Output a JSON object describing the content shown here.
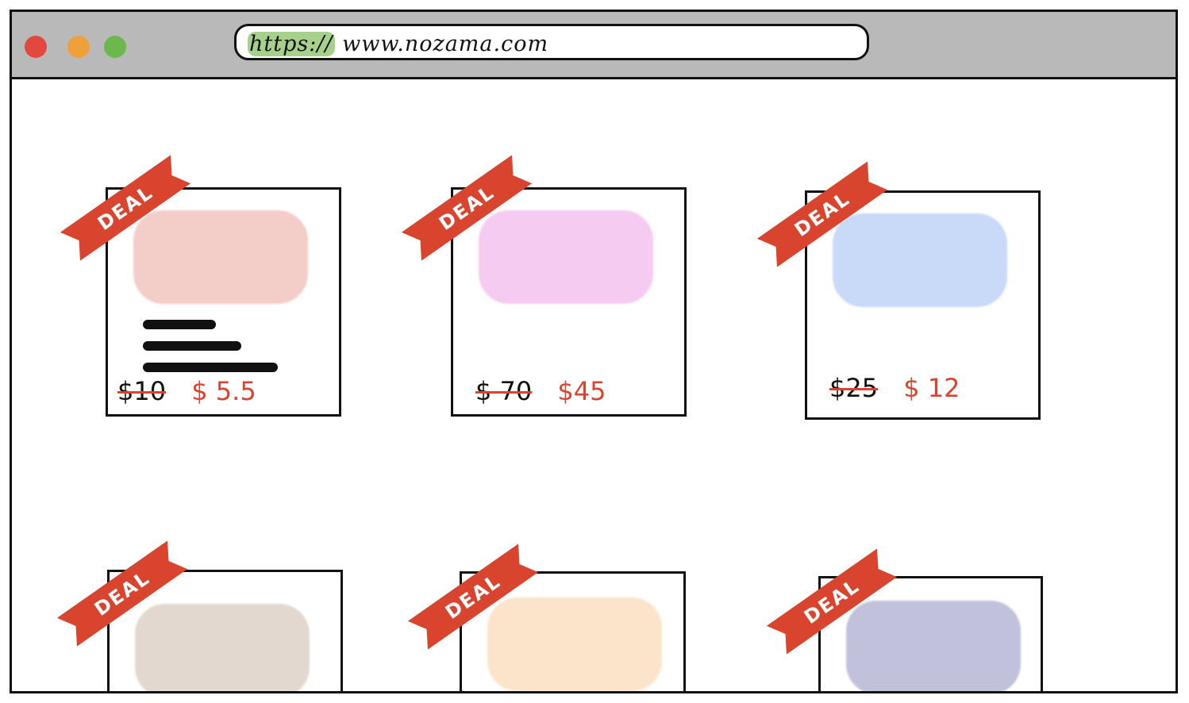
{
  "browser": {
    "url_protocol": "https://",
    "url_rest": "www.nozama.com"
  },
  "deals": [
    {
      "badge": "DEAL",
      "old_price": "$10",
      "new_price": "$ 5.5",
      "image_color": "#f3cdc8",
      "has_description": true
    },
    {
      "badge": "DEAL",
      "old_price": "$ 70",
      "new_price": "$45",
      "image_color": "#f6cbf1",
      "has_description": false
    },
    {
      "badge": "DEAL",
      "old_price": "$25",
      "new_price": "$ 12",
      "image_color": "#c8daf8",
      "has_description": false
    },
    {
      "badge": "DEAL",
      "old_price": "",
      "new_price": "",
      "image_color": "#e2d8d0",
      "has_description": false
    },
    {
      "badge": "DEAL",
      "old_price": "",
      "new_price": "",
      "image_color": "#fbe4ca",
      "has_description": false
    },
    {
      "badge": "DEAL",
      "old_price": "",
      "new_price": "",
      "image_color": "#c2c1dc",
      "has_description": false
    }
  ],
  "colors": {
    "titlebar": "#b9b9b9",
    "deal_red": "#d9442e",
    "url_highlight": "#a8d08d"
  }
}
